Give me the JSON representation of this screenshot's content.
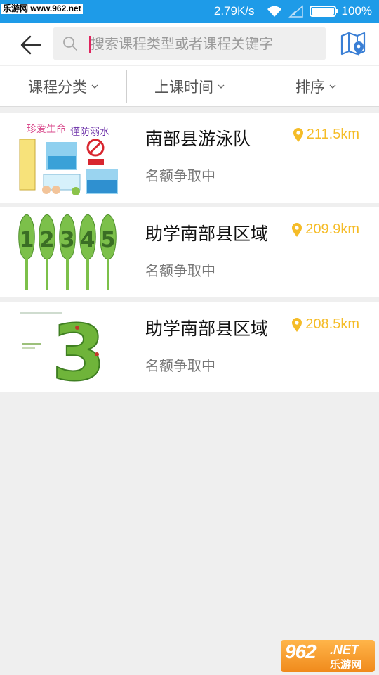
{
  "status_bar": {
    "watermark_top": "乐游网 www.962.net",
    "net_speed": "2.79K/s",
    "battery_percent": "100%",
    "battery_level": 1.0
  },
  "header": {
    "search_placeholder": "搜索课程类型或者课程关键字",
    "back_icon": "arrow-left-icon",
    "map_icon": "map-location-icon",
    "search_icon": "search-icon"
  },
  "filters": [
    {
      "label": "课程分类"
    },
    {
      "label": "上课时间"
    },
    {
      "label": "排序"
    }
  ],
  "courses": [
    {
      "name": "南部县游泳队",
      "status": "名额争取中",
      "distance": "211.5km",
      "thumb_text": [
        "珍爱生命",
        "谨防溺水"
      ]
    },
    {
      "name": "助学南部县区域",
      "status": "名额争取中",
      "distance": "209.9km",
      "thumb_text": [
        "1",
        "2",
        "3",
        "4",
        "5"
      ]
    },
    {
      "name": "助学南部县区域",
      "status": "名额争取中",
      "distance": "208.5km",
      "thumb_text": [
        "3"
      ]
    }
  ],
  "watermark_bottom": {
    "num": "962",
    "net": ".NET",
    "cn": "乐游网"
  },
  "colors": {
    "status_bar": "#1e9be8",
    "distance": "#f5bc28",
    "background": "#efefef"
  }
}
